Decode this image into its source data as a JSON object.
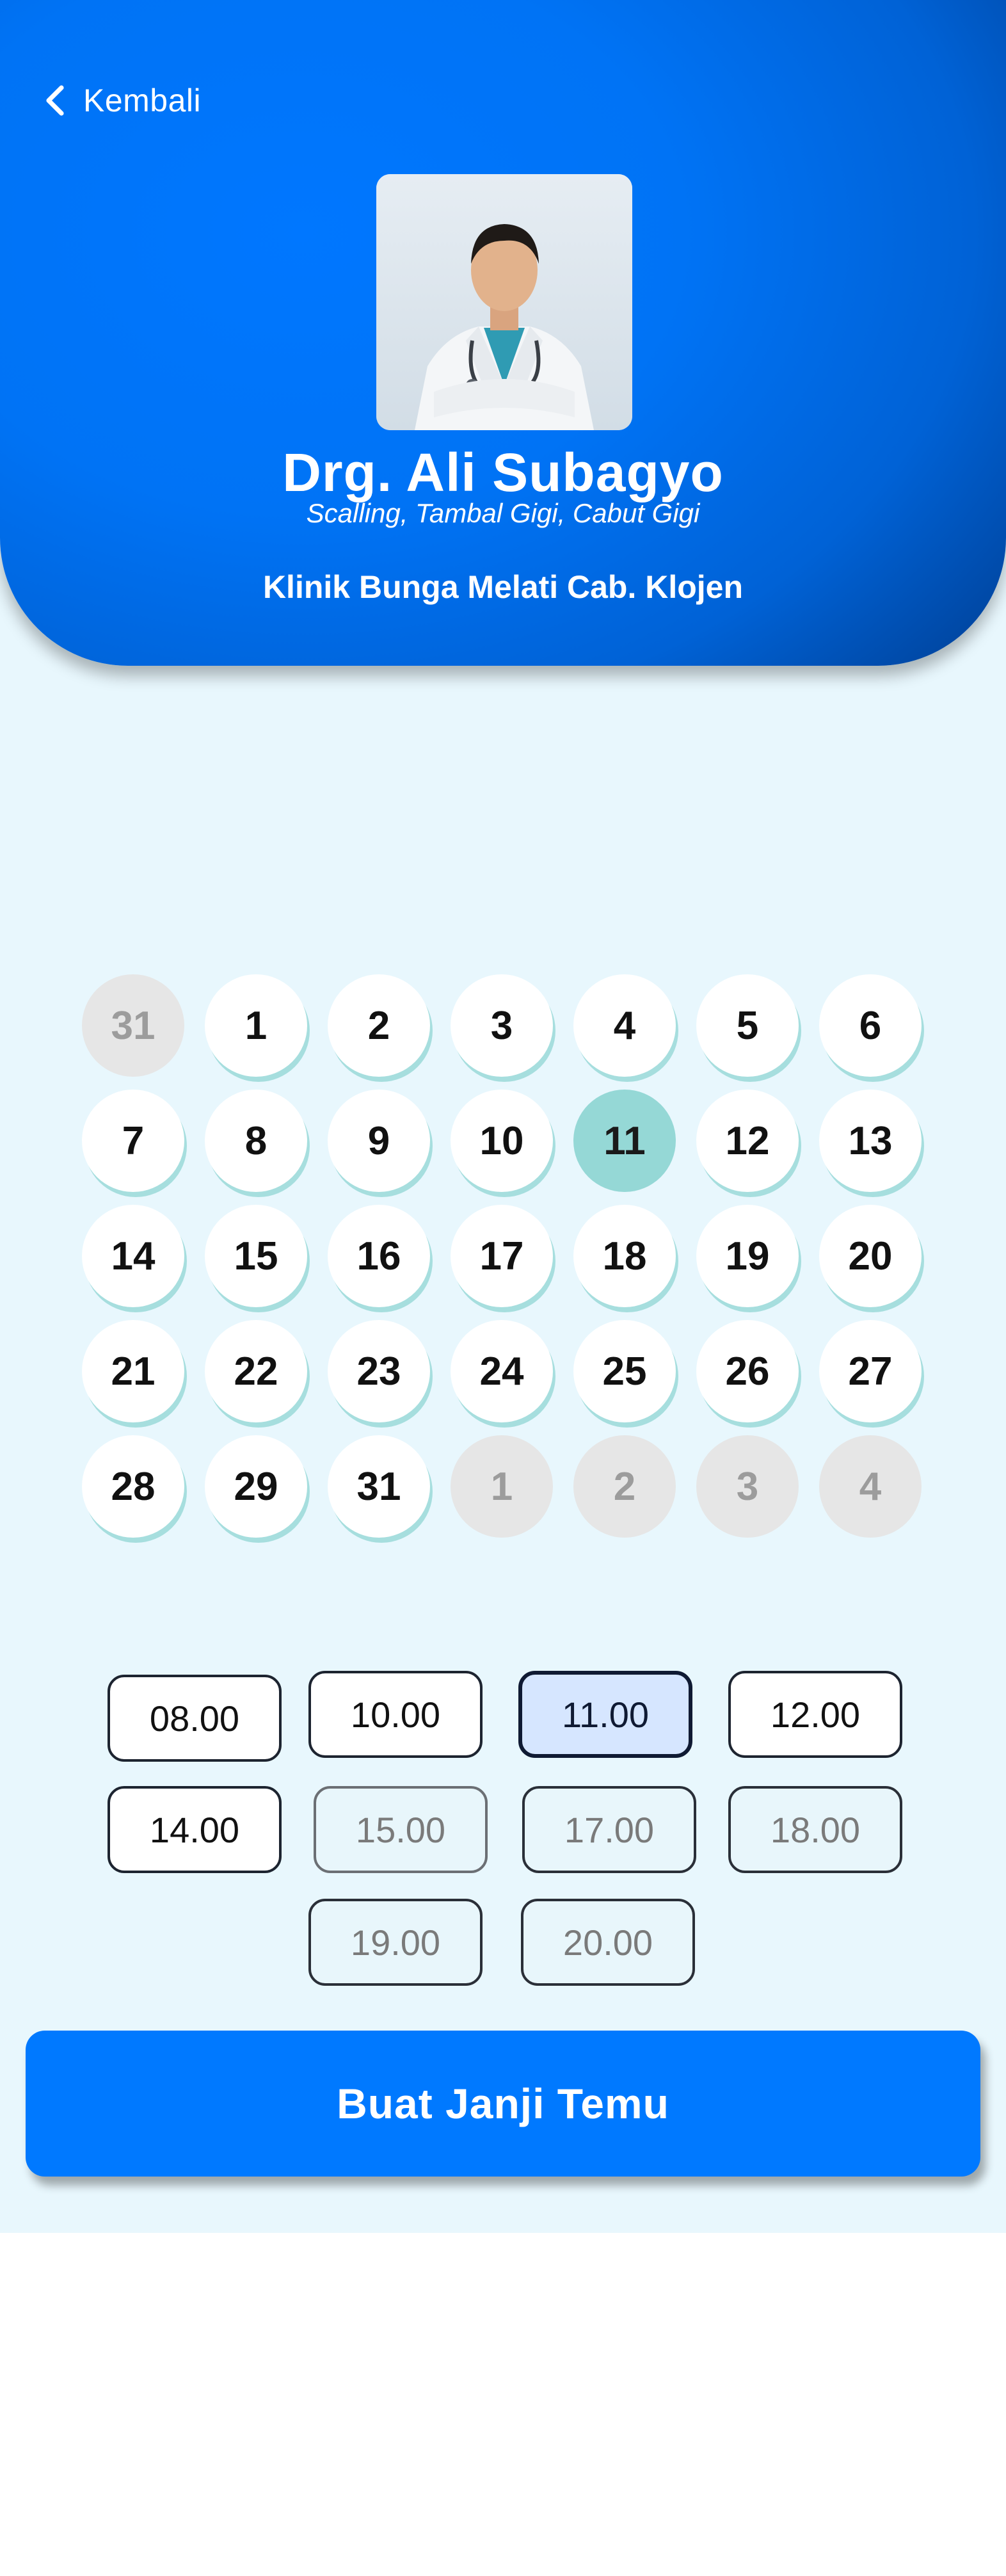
{
  "header": {
    "back_label": "Kembali",
    "doctor_name": "Drg. Ali Subagyo",
    "specialties": "Scalling, Tambal Gigi, Cabut Gigi",
    "clinic": "Klinik Bunga Melati Cab. Klojen",
    "photo_icon": "doctor-portrait"
  },
  "calendar": {
    "days": [
      {
        "label": "31",
        "state": "muted"
      },
      {
        "label": "1",
        "state": "normal"
      },
      {
        "label": "2",
        "state": "normal"
      },
      {
        "label": "3",
        "state": "normal"
      },
      {
        "label": "4",
        "state": "normal"
      },
      {
        "label": "5",
        "state": "normal"
      },
      {
        "label": "6",
        "state": "normal"
      },
      {
        "label": "7",
        "state": "normal"
      },
      {
        "label": "8",
        "state": "normal"
      },
      {
        "label": "9",
        "state": "normal"
      },
      {
        "label": "10",
        "state": "normal"
      },
      {
        "label": "11",
        "state": "selected"
      },
      {
        "label": "12",
        "state": "normal"
      },
      {
        "label": "13",
        "state": "normal"
      },
      {
        "label": "14",
        "state": "normal"
      },
      {
        "label": "15",
        "state": "normal"
      },
      {
        "label": "16",
        "state": "normal"
      },
      {
        "label": "17",
        "state": "normal"
      },
      {
        "label": "18",
        "state": "normal"
      },
      {
        "label": "19",
        "state": "normal"
      },
      {
        "label": "20",
        "state": "normal"
      },
      {
        "label": "21",
        "state": "normal"
      },
      {
        "label": "22",
        "state": "normal"
      },
      {
        "label": "23",
        "state": "normal"
      },
      {
        "label": "24",
        "state": "normal"
      },
      {
        "label": "25",
        "state": "normal"
      },
      {
        "label": "26",
        "state": "normal"
      },
      {
        "label": "27",
        "state": "normal"
      },
      {
        "label": "28",
        "state": "normal"
      },
      {
        "label": "29",
        "state": "normal"
      },
      {
        "label": "31",
        "state": "normal"
      },
      {
        "label": "1",
        "state": "muted"
      },
      {
        "label": "2",
        "state": "muted"
      },
      {
        "label": "3",
        "state": "muted"
      },
      {
        "label": "4",
        "state": "muted"
      }
    ]
  },
  "time_slots": [
    {
      "label": "08.00",
      "state": "available"
    },
    {
      "label": "10.00",
      "state": "available"
    },
    {
      "label": "11.00",
      "state": "selected"
    },
    {
      "label": "12.00",
      "state": "available"
    },
    {
      "label": "14.00",
      "state": "available"
    },
    {
      "label": "15.00",
      "state": "unavailable"
    },
    {
      "label": "17.00",
      "state": "unavailable"
    },
    {
      "label": "18.00",
      "state": "unavailable"
    },
    {
      "label": "19.00",
      "state": "unavailable"
    },
    {
      "label": "20.00",
      "state": "unavailable"
    }
  ],
  "cta": {
    "label": "Buat Janji Temu"
  },
  "colors": {
    "primary": "#0079ff",
    "background": "#e8f7fd",
    "selected_day": "#95d8d6",
    "selected_slot": "#d6e6ff"
  }
}
